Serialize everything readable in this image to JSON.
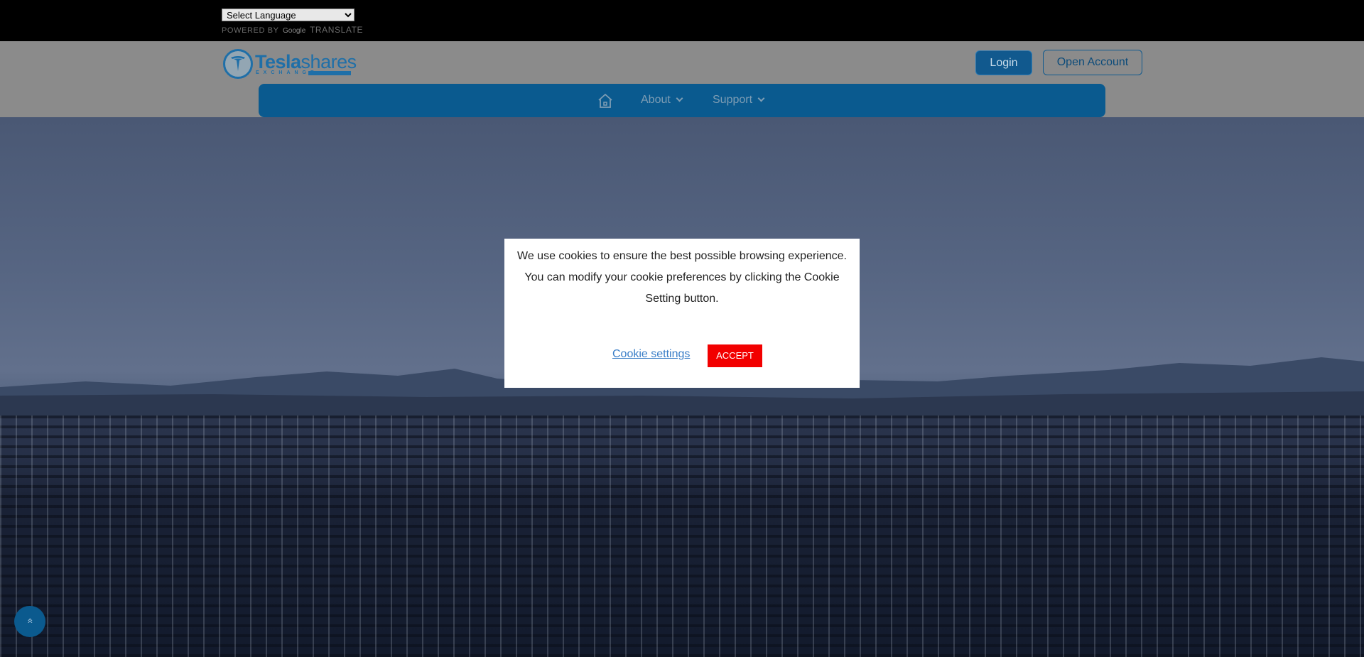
{
  "translate": {
    "select_value": "Select Language",
    "powered_by": "POWERED BY",
    "google": "Google",
    "translate": "TRANSLATE"
  },
  "header": {
    "logo_bold": "Tesla",
    "logo_thin": "shares",
    "logo_sub": "EXCHANGE",
    "login_label": "Login",
    "open_account_label": "Open Account"
  },
  "nav": {
    "home_icon": "home-icon",
    "items": [
      {
        "label": "About"
      },
      {
        "label": "Support"
      }
    ]
  },
  "cookie": {
    "message": "We use cookies to ensure the best possible browsing experience. You can modify your cookie preferences by clicking the Cookie Setting button.",
    "settings_label": "Cookie settings",
    "accept_label": "ACCEPT"
  },
  "scroll_top": {
    "icon": "double-chevron-up-icon",
    "glyph": "»"
  },
  "colors": {
    "brand_blue": "#0a5a8f",
    "accept_red": "#f20000",
    "link_blue": "#3a7ec7"
  }
}
